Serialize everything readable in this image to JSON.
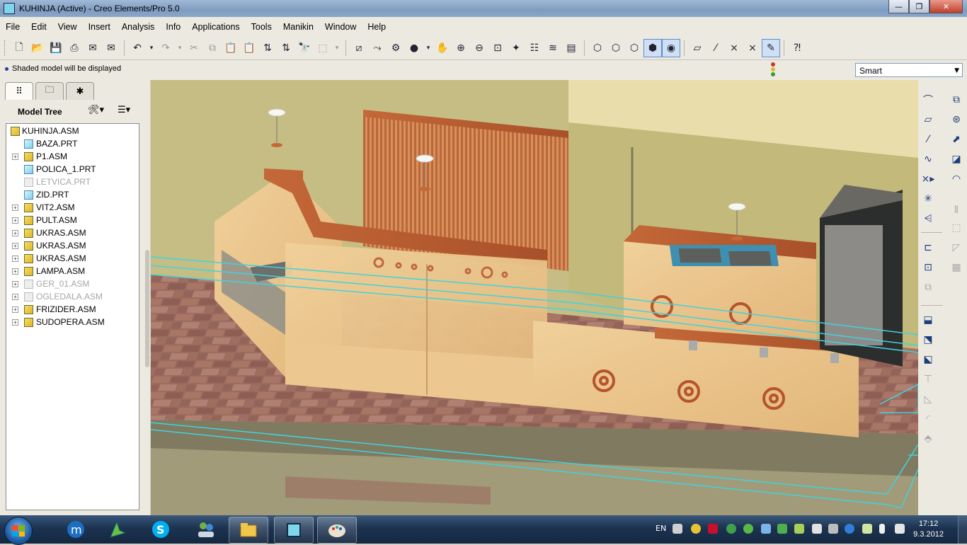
{
  "window": {
    "title": "KUHINJA (Active) - Creo Elements/Pro 5.0",
    "minimize_glyph": "—",
    "maximize_glyph": "❐",
    "close_glyph": "✕"
  },
  "menu": [
    "File",
    "Edit",
    "View",
    "Insert",
    "Analysis",
    "Info",
    "Applications",
    "Tools",
    "Manikin",
    "Window",
    "Help"
  ],
  "toolbar_icons": [
    "new-icon",
    "open-icon",
    "save-icon",
    "print-icon",
    "email-icon",
    "email-link-icon",
    "undo-icon",
    "redo-icon",
    "cut-icon",
    "copy-icon",
    "paste-icon",
    "paste-special-icon",
    "regenerate-icon",
    "regenerate-manager-icon",
    "find-icon",
    "select-box-icon",
    "datum-display-icon",
    "axis-display-icon",
    "point-display-icon",
    "appearance-icon",
    "pan-icon",
    "zoom-in-icon",
    "zoom-out-icon",
    "refit-icon",
    "reorient-icon",
    "saved-views-icon",
    "layers-icon",
    "view-manager-icon",
    "wireframe-icon",
    "hidden-line-icon",
    "no-hidden-icon",
    "shading-icon",
    "enhanced-realism-icon",
    "plane-display-icon",
    "axis-toggle-icon",
    "point-toggle-icon",
    "csys-toggle-icon",
    "annotation-display-icon",
    "context-help-icon"
  ],
  "message": {
    "text": "Shaded model will be displayed"
  },
  "filter": {
    "selected": "Smart"
  },
  "nav_tabs": [
    "model-tree-tab",
    "folder-browser-tab",
    "favorites-tab"
  ],
  "model_tree": {
    "title": "Model Tree",
    "root": "KUHINJA.ASM",
    "items": [
      {
        "label": "BAZA.PRT",
        "type": "prt",
        "expandable": false,
        "suppressed": false
      },
      {
        "label": "P1.ASM",
        "type": "asm",
        "expandable": true,
        "suppressed": false
      },
      {
        "label": "POLICA_1.PRT",
        "type": "prt",
        "expandable": false,
        "suppressed": false
      },
      {
        "label": "LETVICA.PRT",
        "type": "prt",
        "expandable": false,
        "suppressed": true
      },
      {
        "label": "ZID.PRT",
        "type": "prt",
        "expandable": false,
        "suppressed": false
      },
      {
        "label": "VIT2.ASM",
        "type": "asm",
        "expandable": true,
        "suppressed": false
      },
      {
        "label": "PULT.ASM",
        "type": "asm",
        "expandable": true,
        "suppressed": false
      },
      {
        "label": "UKRAS.ASM",
        "type": "asm",
        "expandable": true,
        "suppressed": false
      },
      {
        "label": "UKRAS.ASM",
        "type": "asm",
        "expandable": true,
        "suppressed": false
      },
      {
        "label": "UKRAS.ASM",
        "type": "asm",
        "expandable": true,
        "suppressed": false
      },
      {
        "label": "LAMPA.ASM",
        "type": "asm",
        "expandable": true,
        "suppressed": false
      },
      {
        "label": "GER_01.ASM",
        "type": "asm",
        "expandable": true,
        "suppressed": true
      },
      {
        "label": "OGLEDALA.ASM",
        "type": "asm",
        "expandable": true,
        "suppressed": true
      },
      {
        "label": "FRIZIDER.ASM",
        "type": "asm",
        "expandable": true,
        "suppressed": false
      },
      {
        "label": "SUDOPERA.ASM",
        "type": "asm",
        "expandable": true,
        "suppressed": false
      }
    ]
  },
  "taskbar": {
    "language": "EN",
    "time": "17:12",
    "date": "9.3.2012",
    "apps": [
      "start-button",
      "maxthon-icon",
      "pen-tool-icon",
      "skype-icon",
      "network-people-icon",
      "file-explorer-icon",
      "creo-icon",
      "paint-icon"
    ]
  },
  "colors": {
    "wall": "#c9c088",
    "wood": "#e9c48a",
    "countertop": "#b8582c",
    "floor": "#9c6a5c",
    "highlight": "#3fd3dd"
  }
}
